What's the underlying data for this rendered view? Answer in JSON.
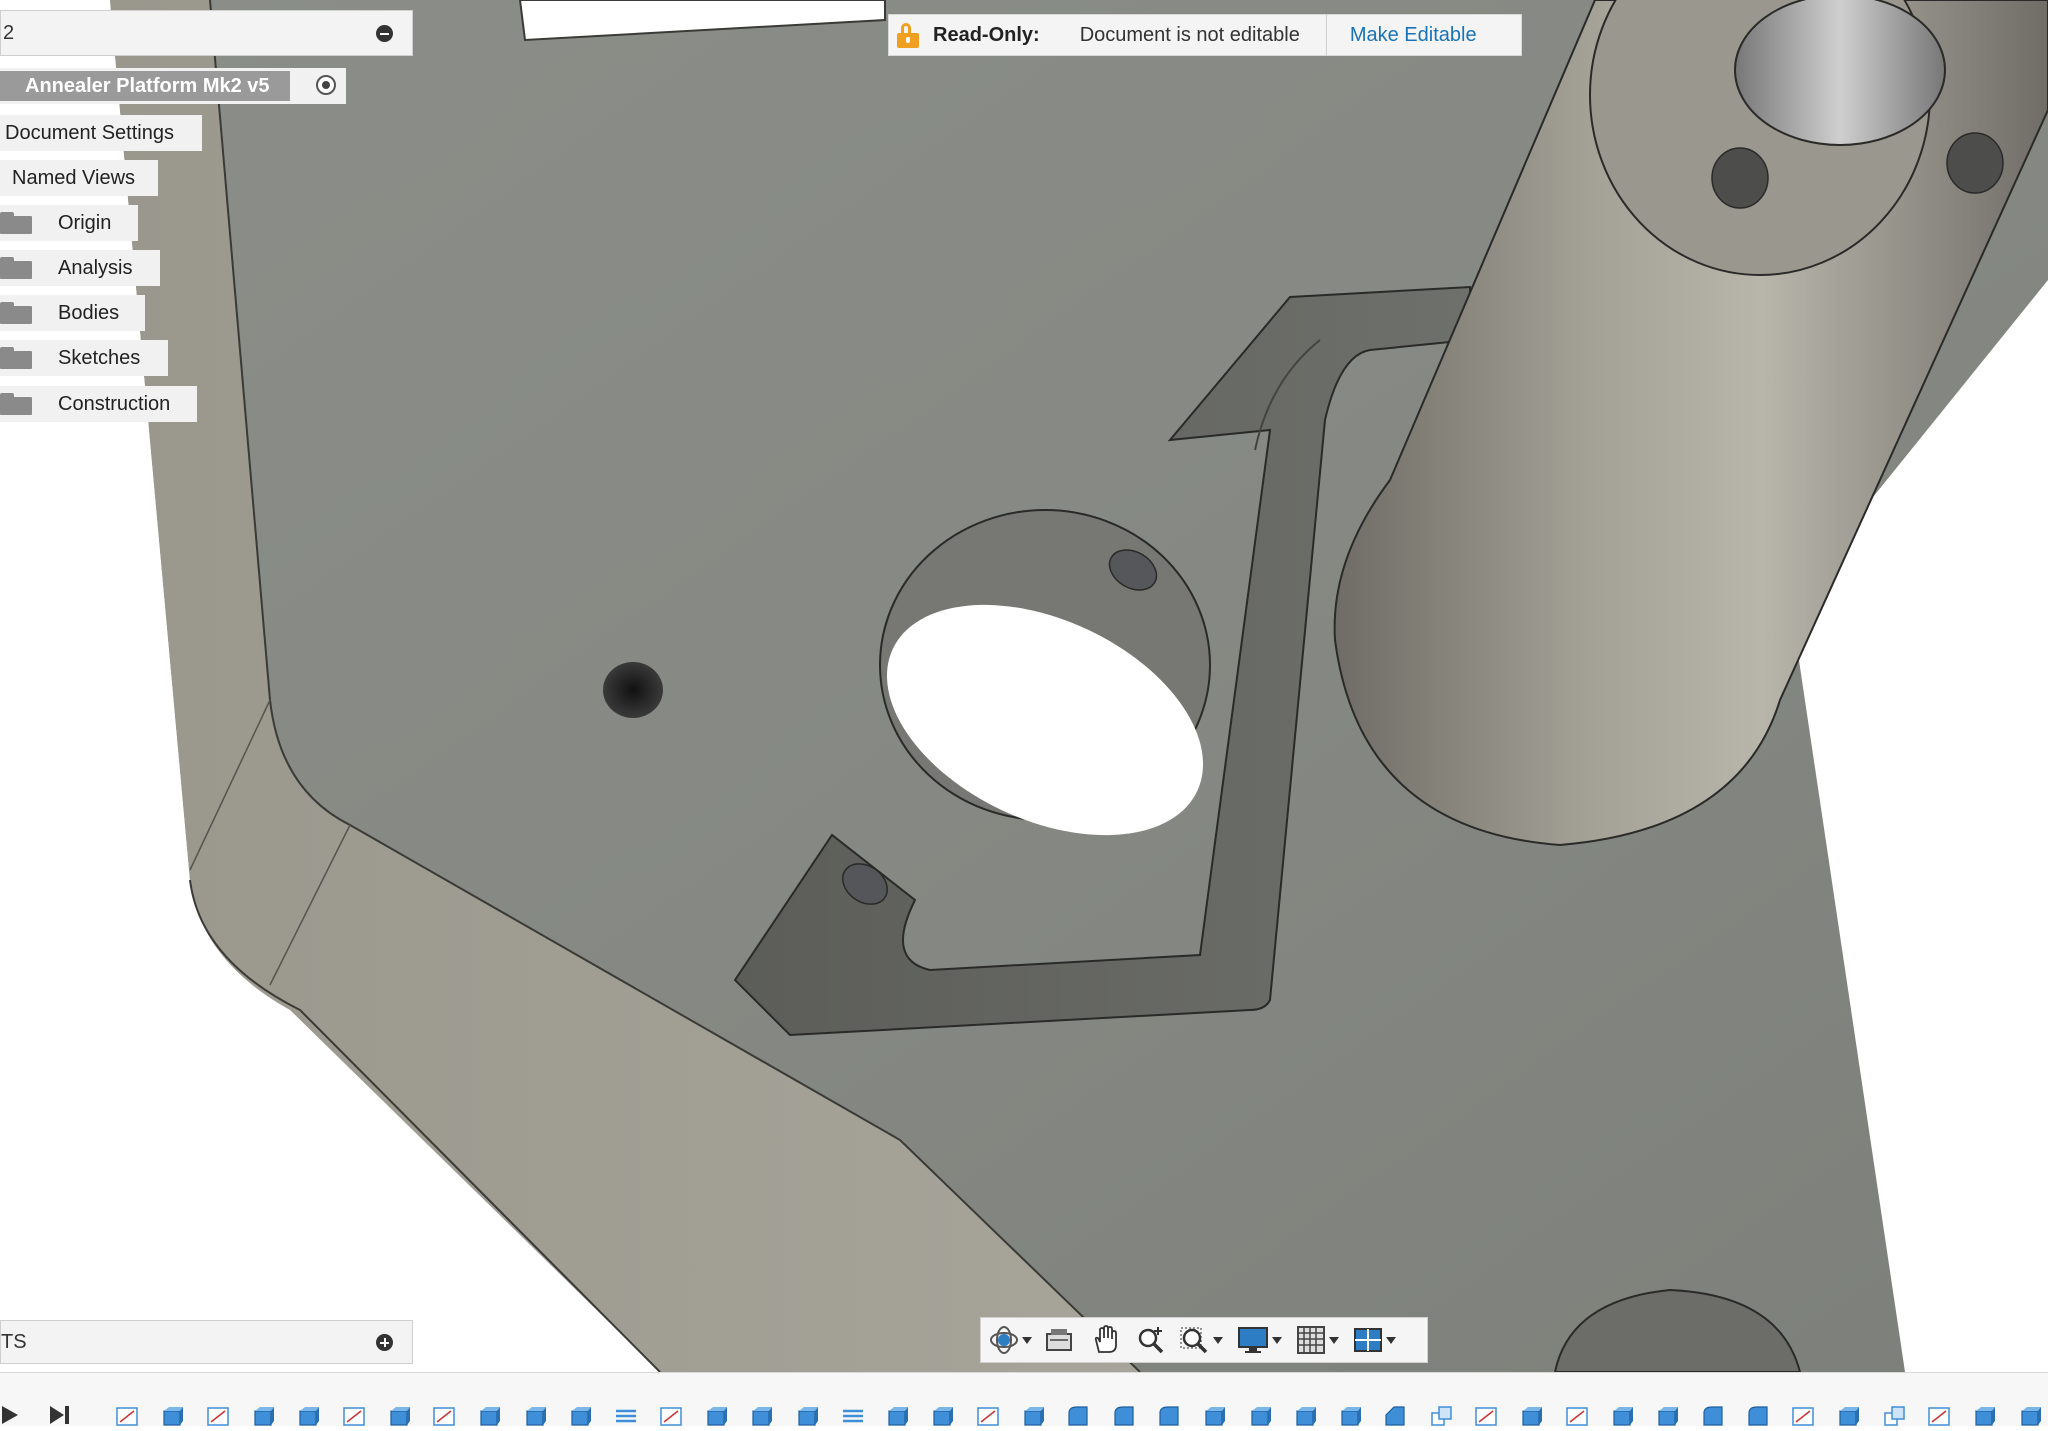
{
  "browser": {
    "title": "2",
    "root": "Annealer Platform Mk2 v5",
    "items": [
      {
        "label": "Document Settings",
        "folder": false,
        "icon": "none"
      },
      {
        "label": "Named Views",
        "folder": false,
        "icon": "none"
      },
      {
        "label": "Origin",
        "folder": true,
        "icon": "folder-icon"
      },
      {
        "label": "Analysis",
        "folder": true,
        "icon": "folder-icon"
      },
      {
        "label": "Bodies",
        "folder": true,
        "icon": "folder-icon"
      },
      {
        "label": "Sketches",
        "folder": true,
        "icon": "folder-icon"
      },
      {
        "label": "Construction",
        "folder": true,
        "icon": "folder-icon"
      }
    ]
  },
  "readonly": {
    "title": "Read-Only:",
    "message": "Document is not editable",
    "action": "Make Editable",
    "lock_color": "#f0a020",
    "link_color": "#1a73b8"
  },
  "comments": {
    "label": "TS"
  },
  "nav_toolbar": {
    "buttons": [
      "orbit-icon",
      "look-at-icon",
      "pan-icon",
      "zoom-icon",
      "zoom-window-icon",
      "display-settings-icon",
      "grid-icon",
      "viewports-icon"
    ]
  },
  "timeline": {
    "controls": [
      "play-icon",
      "step-end-icon"
    ],
    "features": [
      "sketch",
      "extrude",
      "sketch",
      "extrude",
      "extrude",
      "sketch",
      "extrude",
      "sketch",
      "extrude",
      "extrude",
      "extrude",
      "pattern",
      "sketch",
      "extrude",
      "extrude",
      "extrude",
      "pattern",
      "extrude",
      "extrude",
      "sketch",
      "extrude",
      "fillet",
      "fillet",
      "fillet",
      "extrude",
      "extrude",
      "extrude",
      "extrude",
      "chamfer",
      "combine",
      "sketch",
      "extrude",
      "sketch",
      "extrude",
      "extrude",
      "fillet",
      "fillet",
      "sketch",
      "extrude",
      "combine",
      "sketch",
      "extrude",
      "extrude"
    ]
  },
  "colors": {
    "plate_top": "#868a83",
    "plate_edge": "#9e9c91",
    "cylinder": "#8f8d84"
  }
}
